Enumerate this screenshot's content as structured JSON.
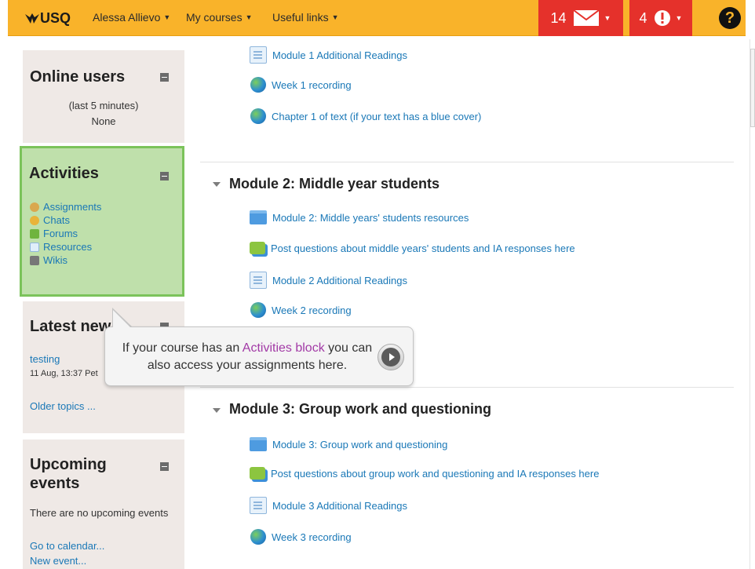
{
  "navbar": {
    "logo": "USQ",
    "user_menu": "Alessa Allievo",
    "my_courses": "My courses",
    "useful_links": "Useful links",
    "messages_count": "14",
    "alerts_count": "4",
    "help": "?"
  },
  "sidebar": {
    "online_users": {
      "title": "Online users",
      "subtitle": "(last 5 minutes)",
      "value": "None"
    },
    "activities": {
      "title": "Activities",
      "items": [
        {
          "label": "Assignments",
          "icon": "assignment-icon"
        },
        {
          "label": "Chats",
          "icon": "chat-icon"
        },
        {
          "label": "Forums",
          "icon": "forum-icon"
        },
        {
          "label": "Resources",
          "icon": "resource-icon"
        },
        {
          "label": "Wikis",
          "icon": "wiki-icon"
        }
      ]
    },
    "latest_news": {
      "title": "Latest new",
      "item_link": "testing",
      "item_meta": "11 Aug, 13:37 Pet",
      "older_topics": "Older topics ..."
    },
    "upcoming_events": {
      "title_line1": "Upcoming",
      "title_line2": "events",
      "empty_text": "There are no upcoming events",
      "go_to_calendar": "Go to calendar...",
      "new_event": "New event..."
    }
  },
  "main": {
    "module1_items": [
      {
        "label": "Module 1 Additional Readings",
        "icon": "page-icon"
      },
      {
        "label": "Week 1 recording",
        "icon": "url-globe-icon"
      },
      {
        "label": "Chapter 1 of text (if your text has a blue cover)",
        "icon": "url-globe-icon"
      }
    ],
    "module2": {
      "title": "Module 2: Middle year students",
      "items": [
        {
          "label": "Module 2: Middle years' students resources",
          "icon": "folder-icon"
        },
        {
          "label": "Post questions about middle years' students and IA responses here",
          "icon": "forum-icon"
        },
        {
          "label": "Module 2 Additional Readings",
          "icon": "page-icon"
        },
        {
          "label": "Week 2 recording",
          "icon": "url-globe-icon"
        }
      ]
    },
    "module3": {
      "title": "Module 3: Group work and questioning",
      "items": [
        {
          "label": "Module 3: Group work and questioning",
          "icon": "folder-icon"
        },
        {
          "label": "Post questions about group work and questioning and IA responses here",
          "icon": "forum-icon"
        },
        {
          "label": "Module 3 Additional Readings",
          "icon": "page-icon"
        },
        {
          "label": "Week 3 recording",
          "icon": "url-globe-icon"
        }
      ]
    }
  },
  "tooltip": {
    "text_before": "If your course has an ",
    "highlight": "Activities block",
    "text_after": " you can also access your assignments here."
  },
  "colors": {
    "navbar": "#f9b32a",
    "badge": "#e5312b",
    "link": "#1a78b7",
    "activities_bg": "#bfe0ab",
    "activities_border": "#7bc35a",
    "highlight": "#a23aa6"
  }
}
